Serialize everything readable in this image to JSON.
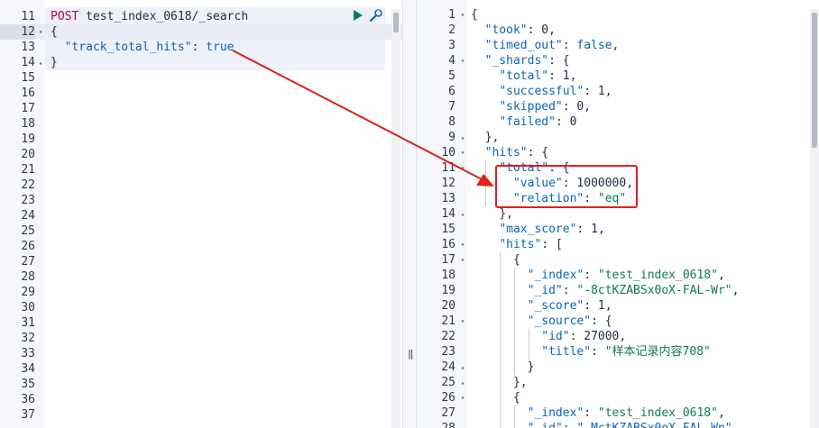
{
  "request": {
    "method": "POST",
    "path": "test_index_0618/_search",
    "body_key": "\"track_total_hits\"",
    "body_value": "true",
    "line_numbers": [
      "11",
      "12",
      "13",
      "14",
      "15",
      "16",
      "17",
      "18",
      "19",
      "20",
      "21",
      "22",
      "23",
      "24",
      "25",
      "26",
      "27",
      "28",
      "29",
      "30",
      "31",
      "32",
      "33",
      "34",
      "35",
      "36",
      "37"
    ]
  },
  "response": {
    "line_numbers": [
      "1",
      "2",
      "3",
      "4",
      "5",
      "6",
      "7",
      "8",
      "9",
      "10",
      "11",
      "12",
      "13",
      "14",
      "15",
      "16",
      "17",
      "18",
      "19",
      "20",
      "21",
      "22",
      "23",
      "24",
      "25",
      "26",
      "27",
      "28"
    ],
    "fields": {
      "took_key": "\"took\"",
      "took_val": "0",
      "timed_out_key": "\"timed_out\"",
      "timed_out_val": "false",
      "shards_key": "\"_shards\"",
      "total_key": "\"total\"",
      "total_val": "1",
      "successful_key": "\"successful\"",
      "successful_val": "1",
      "skipped_key": "\"skipped\"",
      "skipped_val": "0",
      "failed_key": "\"failed\"",
      "failed_val": "0",
      "hits_key": "\"hits\"",
      "hits_total_key": "\"total\"",
      "value_key": "\"value\"",
      "value_val": "1000000",
      "relation_key": "\"relation\"",
      "relation_val": "\"eq\"",
      "max_score_key": "\"max_score\"",
      "max_score_val": "1",
      "index_key": "\"_index\"",
      "index_val": "\"test_index_0618\"",
      "id_key": "\"_id\"",
      "id_val": "\"-8ctKZABSx0oX-FAL-Wr\"",
      "score_key": "\"_score\"",
      "score_val": "1",
      "source_key": "\"_source\"",
      "src_id_key": "\"id\"",
      "src_id_val": "27000",
      "title_key": "\"title\"",
      "title_val": "\"样本记录内容708\"",
      "index2_val": "\"test_index_0618\"",
      "id2_partial": "\"_id\": \"_MctKZABSx0oX-FAL-Wp\""
    }
  },
  "colors": {
    "annotation": "#e0201b",
    "run": "#017d73"
  }
}
